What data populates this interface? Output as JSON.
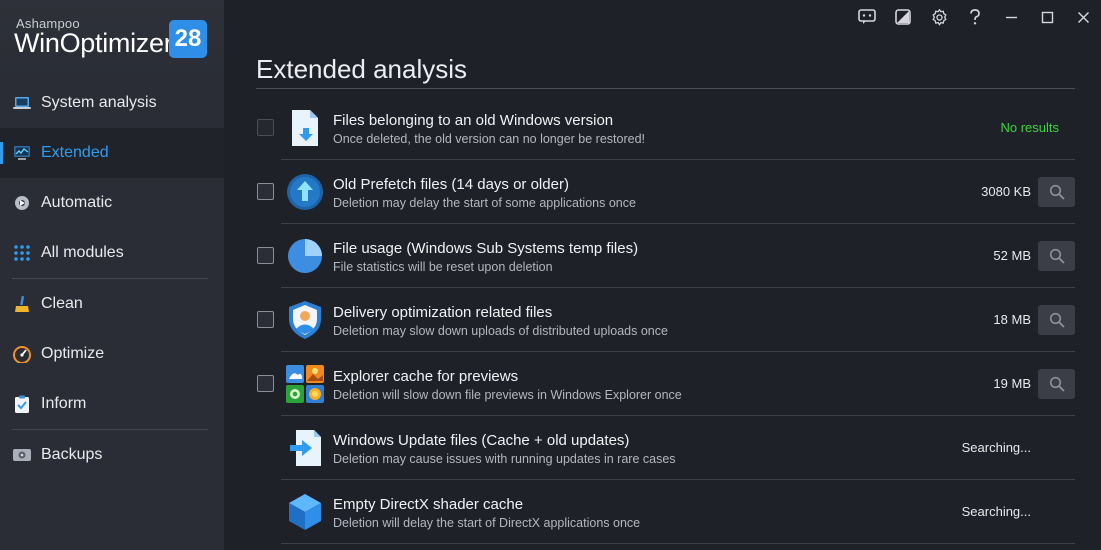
{
  "brand": {
    "company": "Ashampoo",
    "product": "WinOptimizer",
    "version": "28"
  },
  "nav": [
    {
      "label": "System analysis",
      "icon": "laptop-icon"
    },
    {
      "label": "Extended",
      "icon": "monitor-chart-icon",
      "active": true
    },
    {
      "label": "Automatic",
      "icon": "automatic-gear-icon"
    },
    {
      "label": "All modules",
      "icon": "grid-dots-icon"
    },
    {
      "label": "Clean",
      "icon": "broom-icon"
    },
    {
      "label": "Optimize",
      "icon": "speedometer-icon"
    },
    {
      "label": "Inform",
      "icon": "clipboard-icon"
    },
    {
      "label": "Backups",
      "icon": "backup-drive-icon"
    }
  ],
  "titlebar": [
    "feedback-icon",
    "skin-icon",
    "settings-gear-icon",
    "help-icon",
    "minimize-icon",
    "maximize-icon",
    "close-icon"
  ],
  "page": {
    "title": "Extended analysis"
  },
  "colors": {
    "accent": "#2f9cf0",
    "no_results": "#3fd43f"
  },
  "items": [
    {
      "title": "Files belonging to an old Windows version",
      "desc": "Once deleted, the old version can no longer be restored!",
      "value": "No results",
      "icon": "windows-file-icon",
      "checkbox_enabled": false,
      "search_button": false,
      "status": "green"
    },
    {
      "title": "Old Prefetch files (14 days or older)",
      "desc": "Deletion may delay the start of some applications once",
      "value": "3080 KB",
      "icon": "prefetch-arrow-icon",
      "checkbox_enabled": true,
      "search_button": true
    },
    {
      "title": "File usage (Windows Sub Systems temp files)",
      "desc": "File statistics will be reset upon deletion",
      "value": "52 MB",
      "icon": "pie-chart-icon",
      "checkbox_enabled": true,
      "search_button": true
    },
    {
      "title": "Delivery optimization related files",
      "desc": "Deletion may slow down uploads of distributed uploads once",
      "value": "18 MB",
      "icon": "user-shield-icon",
      "checkbox_enabled": true,
      "search_button": true
    },
    {
      "title": "Explorer cache for previews",
      "desc": "Deletion will slow down file previews in Windows Explorer once",
      "value": "19 MB",
      "icon": "preview-tiles-icon",
      "checkbox_enabled": true,
      "search_button": true
    },
    {
      "title": "Windows Update files (Cache + old updates)",
      "desc": "Deletion may cause issues with running updates in rare cases",
      "value": "Searching...",
      "icon": "windows-update-icon",
      "checkbox_enabled": false,
      "search_button": false
    },
    {
      "title": "Empty DirectX shader cache",
      "desc": "Deletion will delay the start of DirectX applications once",
      "value": "Searching...",
      "icon": "directx-cube-icon",
      "checkbox_enabled": false,
      "search_button": false
    }
  ]
}
